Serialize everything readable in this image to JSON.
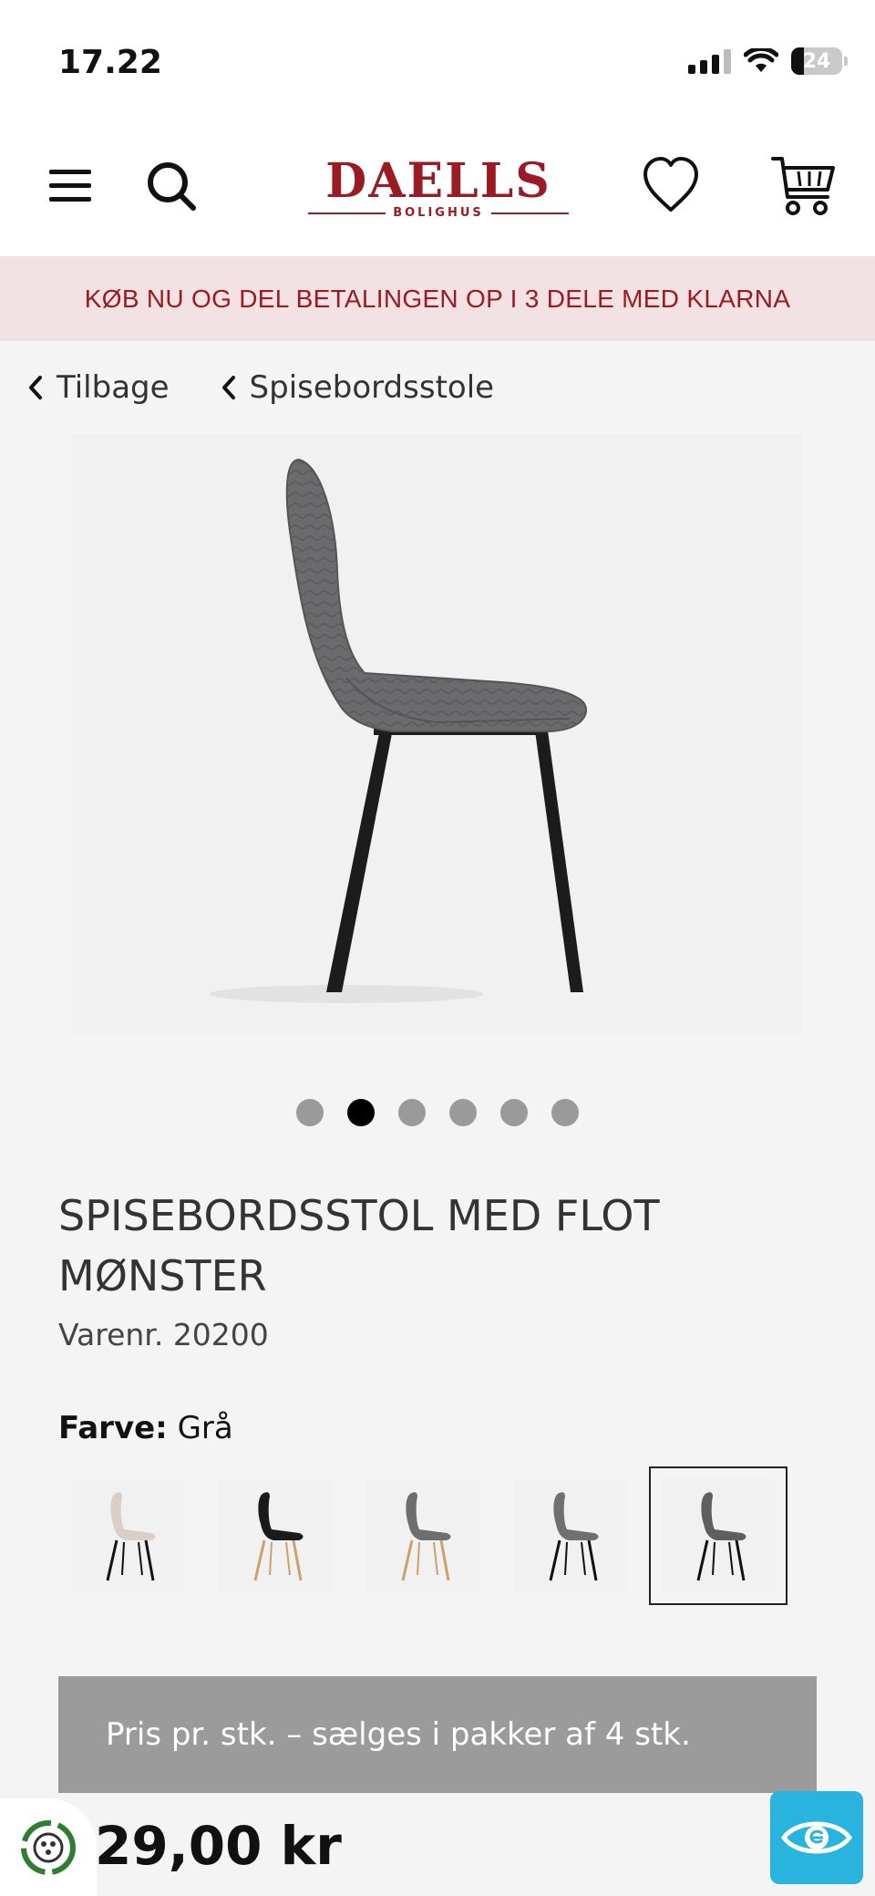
{
  "status_bar": {
    "time": "17.22",
    "battery": "24"
  },
  "header": {
    "logo_main": "DAELLS",
    "logo_sub": "BOLIGHUS",
    "brand_color": "#9b1b24"
  },
  "banner": {
    "text": "KØB NU OG DEL BETALINGEN OP I 3 DELE MED KLARNA",
    "background": "#f3e2e3"
  },
  "breadcrumbs": [
    {
      "label": "Tilbage",
      "icon": "chevron-left-icon"
    },
    {
      "label": "Spisebordsstole",
      "icon": "chevron-left-icon"
    }
  ],
  "gallery": {
    "image_count": 6,
    "active_index": 1
  },
  "product": {
    "title": "SPISEBORDSSTOL MED FLOT MØNSTER",
    "sku": "Varenr. 20200",
    "color_label": "Farve:",
    "color_value": "Grå",
    "swatches": [
      {
        "name": "beige-black-legs",
        "seat": "#d9cfc6",
        "legs": "#111111"
      },
      {
        "name": "black-wood-legs",
        "seat": "#1a1a1a",
        "legs": "#c8a36a"
      },
      {
        "name": "grey-wood-legs",
        "seat": "#6e6e70",
        "legs": "#c8a36a"
      },
      {
        "name": "grey-black-legs",
        "seat": "#707072",
        "legs": "#111111"
      },
      {
        "name": "dark-grey-black-legs",
        "seat": "#5f5f61",
        "legs": "#111111"
      }
    ],
    "selected_swatch": 4,
    "pack_note": "Pris pr. stk. – sælges i pakker af 4 stk.",
    "price": "29,00 kr"
  }
}
